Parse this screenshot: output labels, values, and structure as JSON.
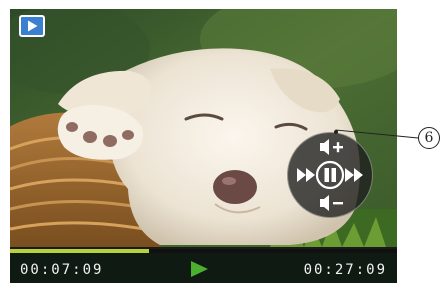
{
  "player": {
    "elapsed_time": "00:07:09",
    "total_time": "00:27:09",
    "progress_fraction": 0.36,
    "mode_icon": "playback-mode-icon",
    "accent_color": "#3a7fd0",
    "progress_color": "#b6d23a",
    "play_color": "#4caf2e"
  },
  "control_dial": {
    "icons": [
      "volume-up-icon",
      "rewind-icon",
      "pause-icon",
      "fast-forward-icon",
      "volume-down-icon"
    ]
  },
  "callout": {
    "number": "6"
  }
}
